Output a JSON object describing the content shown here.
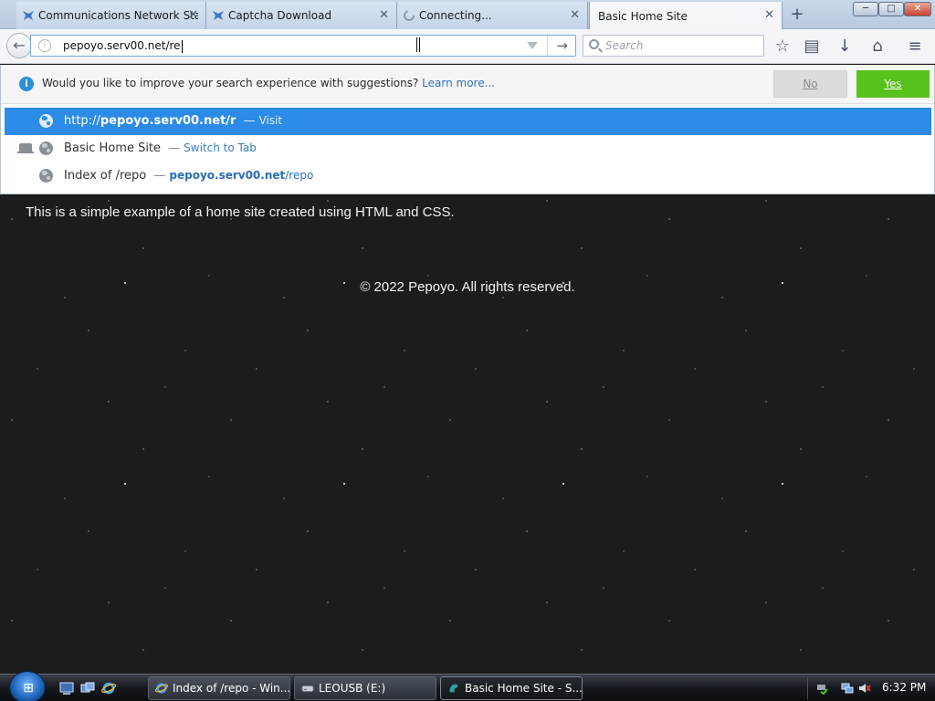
{
  "browser": {
    "tabs": [
      {
        "title": "Communications Network Status",
        "icon": "fox-icon"
      },
      {
        "title": "Captcha Download",
        "icon": "fox-icon"
      },
      {
        "title": "Connecting...",
        "icon": "loading-icon"
      },
      {
        "title": "Basic Home Site",
        "icon": "none",
        "active": true
      }
    ],
    "new_tab": "+",
    "window_controls": {
      "minimize": "─",
      "maximize": "□",
      "close": "✕"
    },
    "url": "pepoyo.serv00.net/re",
    "search_placeholder": "Search",
    "go_arrow": "→",
    "toolbar_icons": {
      "bookmark": "☆",
      "reading_list": "▤",
      "download": "↓",
      "home": "⌂",
      "menu": "≡"
    }
  },
  "dropdown": {
    "notice": {
      "text": "Would you like to improve your search experience with suggestions?",
      "link": "Learn more...",
      "no_label": "No",
      "yes_label": "Yes"
    },
    "rows": [
      {
        "prefix": "http://",
        "url_bold": "pepoyo.serv00.net/r",
        "sep": "—",
        "action": "Visit"
      },
      {
        "title": "Basic Home Site",
        "sep": "—",
        "action": "Switch to Tab"
      },
      {
        "title": "Index of /repo",
        "sep": "—",
        "url_bold": "pepoyo.serv00.net",
        "url_rest": "/repo"
      }
    ]
  },
  "page": {
    "intro": "This is a simple example of a home site created using HTML and CSS.",
    "footer": "© 2022 Pepoyo. All rights reserved."
  },
  "taskbar": {
    "start": "⊞",
    "buttons": [
      {
        "label": "Index of /repo - Win..."
      },
      {
        "label": "LEOUSB (E:)"
      },
      {
        "label": "Basic Home Site - S...",
        "active": true
      }
    ],
    "clock": "6:32 PM"
  }
}
